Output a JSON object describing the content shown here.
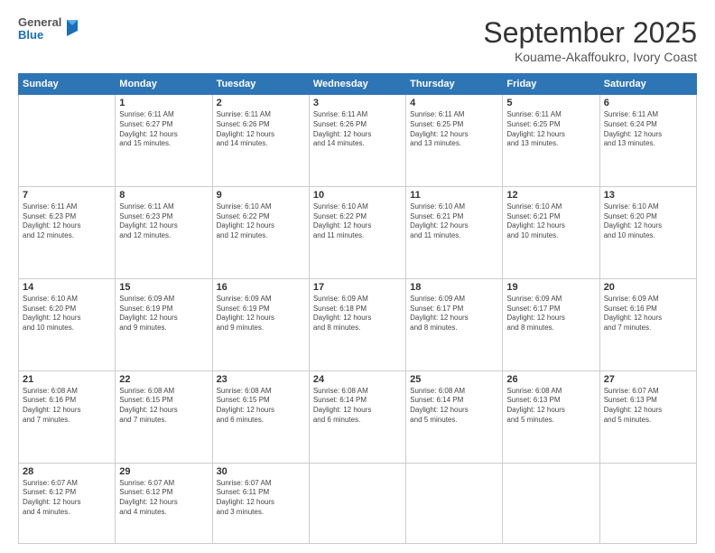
{
  "header": {
    "logo_general": "General",
    "logo_blue": "Blue",
    "month_title": "September 2025",
    "location": "Kouame-Akaffoukro, Ivory Coast"
  },
  "calendar": {
    "days": [
      "Sunday",
      "Monday",
      "Tuesday",
      "Wednesday",
      "Thursday",
      "Friday",
      "Saturday"
    ],
    "weeks": [
      [
        {
          "day": "",
          "info": ""
        },
        {
          "day": "1",
          "info": "Sunrise: 6:11 AM\nSunset: 6:27 PM\nDaylight: 12 hours\nand 15 minutes."
        },
        {
          "day": "2",
          "info": "Sunrise: 6:11 AM\nSunset: 6:26 PM\nDaylight: 12 hours\nand 14 minutes."
        },
        {
          "day": "3",
          "info": "Sunrise: 6:11 AM\nSunset: 6:26 PM\nDaylight: 12 hours\nand 14 minutes."
        },
        {
          "day": "4",
          "info": "Sunrise: 6:11 AM\nSunset: 6:25 PM\nDaylight: 12 hours\nand 13 minutes."
        },
        {
          "day": "5",
          "info": "Sunrise: 6:11 AM\nSunset: 6:25 PM\nDaylight: 12 hours\nand 13 minutes."
        },
        {
          "day": "6",
          "info": "Sunrise: 6:11 AM\nSunset: 6:24 PM\nDaylight: 12 hours\nand 13 minutes."
        }
      ],
      [
        {
          "day": "7",
          "info": "Sunrise: 6:11 AM\nSunset: 6:23 PM\nDaylight: 12 hours\nand 12 minutes."
        },
        {
          "day": "8",
          "info": "Sunrise: 6:11 AM\nSunset: 6:23 PM\nDaylight: 12 hours\nand 12 minutes."
        },
        {
          "day": "9",
          "info": "Sunrise: 6:10 AM\nSunset: 6:22 PM\nDaylight: 12 hours\nand 12 minutes."
        },
        {
          "day": "10",
          "info": "Sunrise: 6:10 AM\nSunset: 6:22 PM\nDaylight: 12 hours\nand 11 minutes."
        },
        {
          "day": "11",
          "info": "Sunrise: 6:10 AM\nSunset: 6:21 PM\nDaylight: 12 hours\nand 11 minutes."
        },
        {
          "day": "12",
          "info": "Sunrise: 6:10 AM\nSunset: 6:21 PM\nDaylight: 12 hours\nand 10 minutes."
        },
        {
          "day": "13",
          "info": "Sunrise: 6:10 AM\nSunset: 6:20 PM\nDaylight: 12 hours\nand 10 minutes."
        }
      ],
      [
        {
          "day": "14",
          "info": "Sunrise: 6:10 AM\nSunset: 6:20 PM\nDaylight: 12 hours\nand 10 minutes."
        },
        {
          "day": "15",
          "info": "Sunrise: 6:09 AM\nSunset: 6:19 PM\nDaylight: 12 hours\nand 9 minutes."
        },
        {
          "day": "16",
          "info": "Sunrise: 6:09 AM\nSunset: 6:19 PM\nDaylight: 12 hours\nand 9 minutes."
        },
        {
          "day": "17",
          "info": "Sunrise: 6:09 AM\nSunset: 6:18 PM\nDaylight: 12 hours\nand 8 minutes."
        },
        {
          "day": "18",
          "info": "Sunrise: 6:09 AM\nSunset: 6:17 PM\nDaylight: 12 hours\nand 8 minutes."
        },
        {
          "day": "19",
          "info": "Sunrise: 6:09 AM\nSunset: 6:17 PM\nDaylight: 12 hours\nand 8 minutes."
        },
        {
          "day": "20",
          "info": "Sunrise: 6:09 AM\nSunset: 6:16 PM\nDaylight: 12 hours\nand 7 minutes."
        }
      ],
      [
        {
          "day": "21",
          "info": "Sunrise: 6:08 AM\nSunset: 6:16 PM\nDaylight: 12 hours\nand 7 minutes."
        },
        {
          "day": "22",
          "info": "Sunrise: 6:08 AM\nSunset: 6:15 PM\nDaylight: 12 hours\nand 7 minutes."
        },
        {
          "day": "23",
          "info": "Sunrise: 6:08 AM\nSunset: 6:15 PM\nDaylight: 12 hours\nand 6 minutes."
        },
        {
          "day": "24",
          "info": "Sunrise: 6:08 AM\nSunset: 6:14 PM\nDaylight: 12 hours\nand 6 minutes."
        },
        {
          "day": "25",
          "info": "Sunrise: 6:08 AM\nSunset: 6:14 PM\nDaylight: 12 hours\nand 5 minutes."
        },
        {
          "day": "26",
          "info": "Sunrise: 6:08 AM\nSunset: 6:13 PM\nDaylight: 12 hours\nand 5 minutes."
        },
        {
          "day": "27",
          "info": "Sunrise: 6:07 AM\nSunset: 6:13 PM\nDaylight: 12 hours\nand 5 minutes."
        }
      ],
      [
        {
          "day": "28",
          "info": "Sunrise: 6:07 AM\nSunset: 6:12 PM\nDaylight: 12 hours\nand 4 minutes."
        },
        {
          "day": "29",
          "info": "Sunrise: 6:07 AM\nSunset: 6:12 PM\nDaylight: 12 hours\nand 4 minutes."
        },
        {
          "day": "30",
          "info": "Sunrise: 6:07 AM\nSunset: 6:11 PM\nDaylight: 12 hours\nand 3 minutes."
        },
        {
          "day": "",
          "info": ""
        },
        {
          "day": "",
          "info": ""
        },
        {
          "day": "",
          "info": ""
        },
        {
          "day": "",
          "info": ""
        }
      ]
    ]
  }
}
